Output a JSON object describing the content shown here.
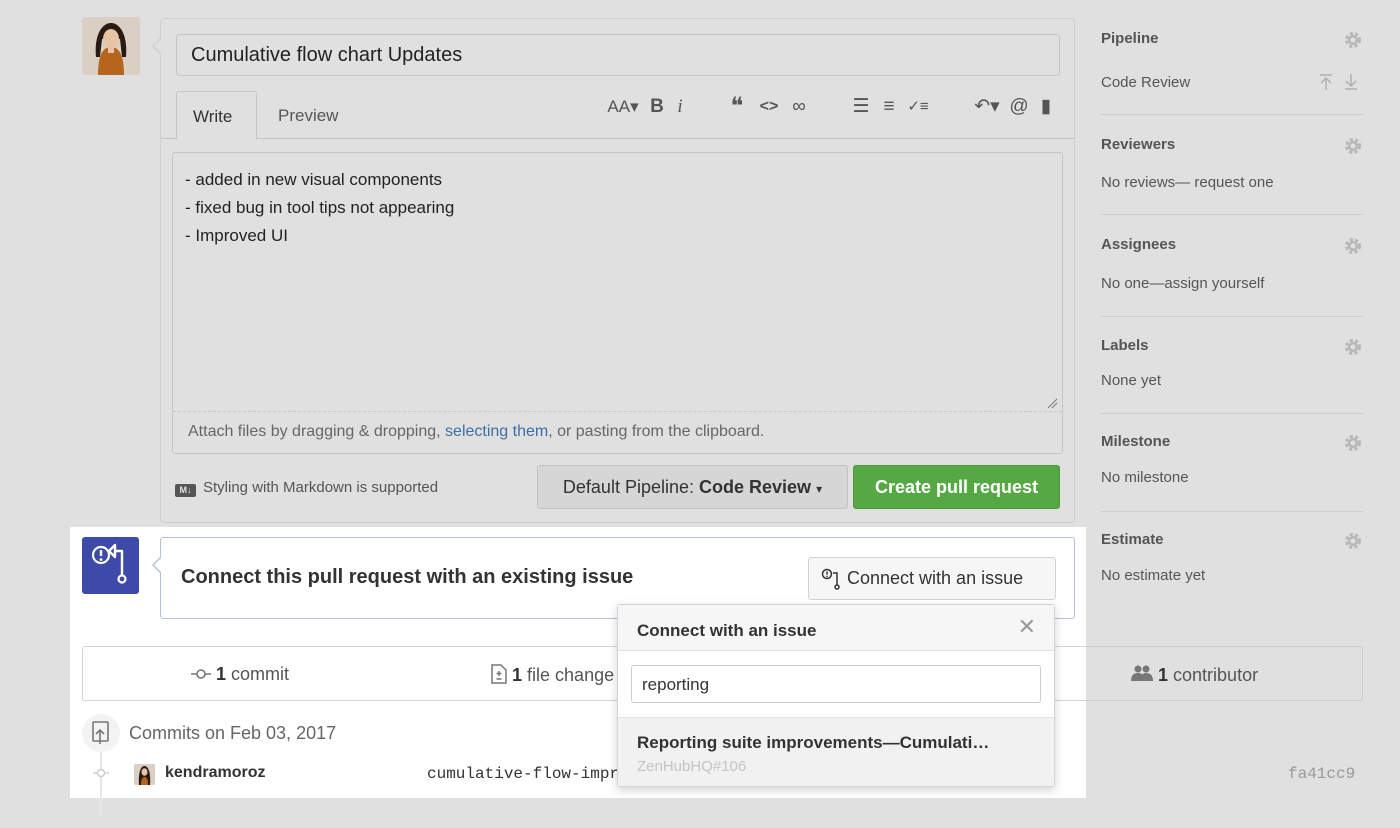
{
  "pr_form": {
    "title": "Cumulative flow chart Updates",
    "tabs": [
      "Write",
      "Preview"
    ],
    "toolbar_icons": [
      "text-size-icon",
      "bold-icon",
      "italic-icon",
      "quote-icon",
      "code-icon",
      "link-icon",
      "bullet-list-icon",
      "numbered-list-icon",
      "task-list-icon",
      "reply-icon",
      "mention-icon",
      "bookmark-icon"
    ],
    "toolbar_glyphs": {
      "text_size": "AA▾",
      "bold": "B",
      "italic": "i",
      "quote": "❝",
      "code": "<>",
      "link": "∞",
      "bullet_list": "☰",
      "numbered_list": "≡",
      "task_list": "✓≡",
      "reply": "↶▾",
      "mention": "@",
      "bookmark": "▮"
    },
    "body_lines": [
      "- added in new visual components",
      "- fixed bug in tool tips not appearing",
      "- Improved UI"
    ],
    "attach_prefix": "Attach files by dragging & dropping, ",
    "attach_link": "selecting them",
    "attach_suffix": ", or pasting from the clipboard.",
    "markdown_badge": "M↓",
    "markdown_note": "Styling with Markdown is supported",
    "pipeline_prefix": "Default Pipeline: ",
    "pipeline_value": "Code Review",
    "pipeline_caret": "▾",
    "create_button": "Create pull request"
  },
  "sidebar": {
    "pipeline": {
      "heading": "Pipeline",
      "value": "Code Review"
    },
    "reviewers": {
      "heading": "Reviewers",
      "value": "No reviews— request one"
    },
    "assignees": {
      "heading": "Assignees",
      "value": "No one—assign yourself"
    },
    "labels": {
      "heading": "Labels",
      "value": "None yet"
    },
    "milestone": {
      "heading": "Milestone",
      "value": "No milestone"
    },
    "estimate": {
      "heading": "Estimate",
      "value": "No estimate yet"
    }
  },
  "connect": {
    "title": "Connect this pull request with an existing issue",
    "button": "Connect with an issue"
  },
  "stats": {
    "commits_count": "1",
    "commits_label": " commit",
    "files_count": "1",
    "files_label": " file change",
    "contributors_count": "1",
    "contributors_label": " contributor"
  },
  "commits": {
    "date_label": "Commits on Feb 03, 2017",
    "user": "kendramoroz",
    "message": "cumulative-flow-impr",
    "sha": "fa41cc9"
  },
  "dropdown": {
    "title": "Connect with an issue",
    "close": "✕",
    "search_value": "reporting",
    "result_title": "Reporting suite improvements—Cumulati…",
    "result_ref": "ZenHubHQ#106"
  },
  "colors": {
    "create_button": "#55a844",
    "zenhub_icon": "#3d4aa8",
    "link": "#3b6ea5"
  }
}
